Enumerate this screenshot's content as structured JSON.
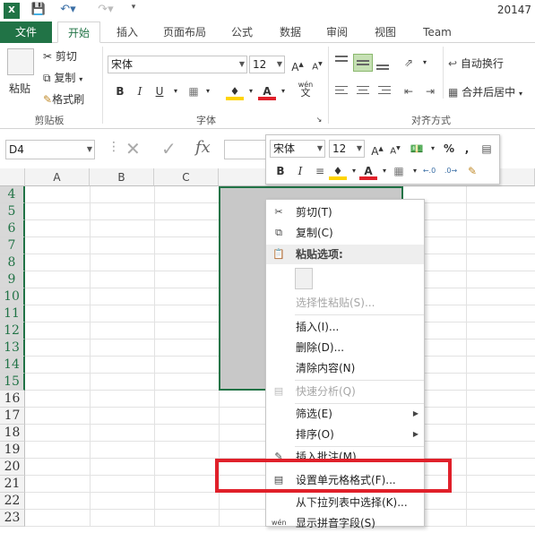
{
  "title": "20147",
  "tabs": [
    "文件",
    "开始",
    "插入",
    "页面布局",
    "公式",
    "数据",
    "审阅",
    "视图",
    "Team"
  ],
  "ribbon": {
    "clipboard": {
      "paste": "粘贴",
      "cut": "剪切",
      "copy": "复制",
      "format_painter": "格式刷",
      "label": "剪贴板"
    },
    "font": {
      "name": "宋体",
      "size": "12",
      "label": "字体",
      "bold": "B",
      "italic": "I",
      "underline": "U",
      "wen": "wén",
      "wen_char": "文"
    },
    "alignment": {
      "wrap": "自动换行",
      "merge": "合并后居中",
      "label": "对齐方式"
    }
  },
  "formula_bar": {
    "name_box": "D4",
    "fx": "fx"
  },
  "grid": {
    "columns": [
      "A",
      "B",
      "C"
    ],
    "rows": [
      "4",
      "5",
      "6",
      "7",
      "8",
      "9",
      "10",
      "11",
      "12",
      "13",
      "14",
      "15",
      "16",
      "17",
      "18",
      "19",
      "20",
      "21",
      "22",
      "23"
    ]
  },
  "mini_toolbar": {
    "font": "宋体",
    "size": "12",
    "bold": "B",
    "italic": "I",
    "percent": "%",
    "comma": ","
  },
  "context_menu": {
    "cut": "剪切(T)",
    "copy": "复制(C)",
    "paste_options": "粘贴选项:",
    "paste_special": "选择性粘贴(S)...",
    "insert": "插入(I)...",
    "delete": "删除(D)...",
    "clear": "清除内容(N)",
    "quick_analysis": "快速分析(Q)",
    "filter": "筛选(E)",
    "sort": "排序(O)",
    "insert_comment": "插入批注(M)",
    "format_cells": "设置单元格格式(F)...",
    "pick_from_list": "从下拉列表中选择(K)...",
    "show_phonetic": "显示拼音字段(S)"
  },
  "colors": {
    "accent": "#217346",
    "highlight": "#e0202a",
    "selection": "#c8c8c8"
  }
}
